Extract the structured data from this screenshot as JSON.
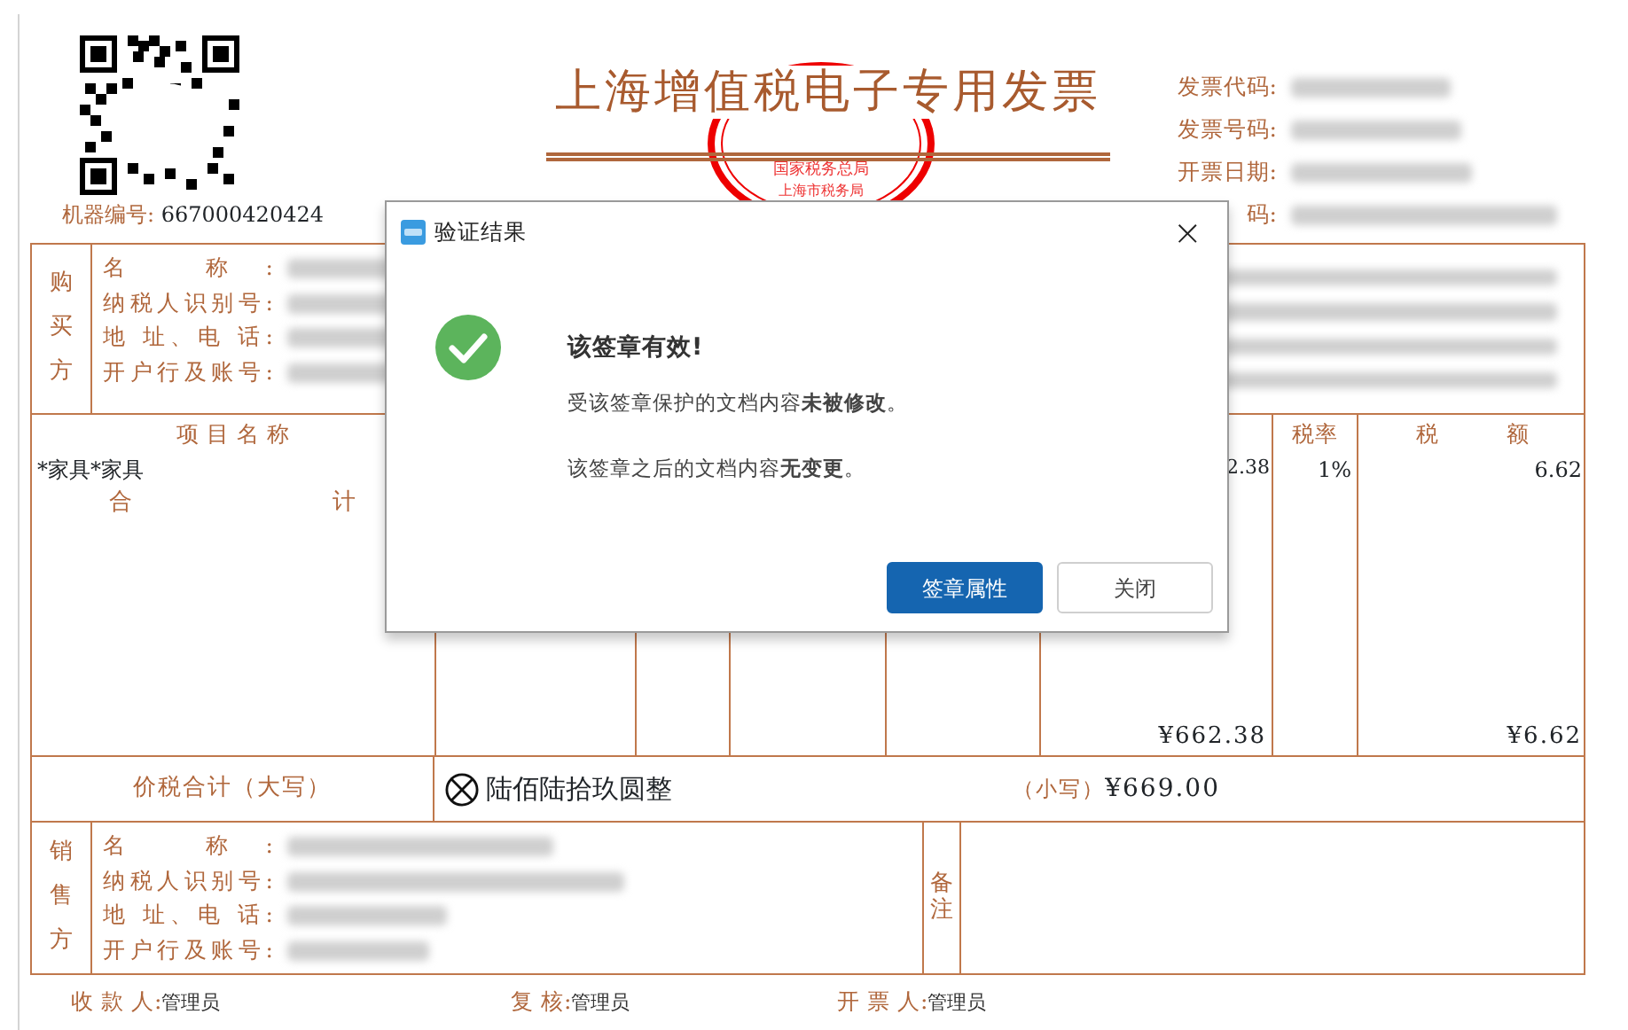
{
  "header": {
    "machine_no_label": "机器编号:",
    "machine_no": "667000420424",
    "title": "上海增值税电子专用发票",
    "seal": {
      "line1": "国家税务总局",
      "line2": "上海市税务局"
    },
    "info": [
      {
        "label": "发票代码:",
        "redacted": true
      },
      {
        "label": "发票号码:",
        "redacted": true
      },
      {
        "label": "开票日期:",
        "redacted": true
      },
      {
        "label": "码:",
        "redacted": true
      }
    ]
  },
  "buyer": {
    "side": "购买方",
    "fields": [
      {
        "label": "名 称:",
        "redacted": true
      },
      {
        "label": "纳税人识别号:",
        "redacted": true
      },
      {
        "label": "地 址、电 话:",
        "redacted": true
      },
      {
        "label": "开户行及账号:",
        "redacted": true
      }
    ],
    "cipher_redacted": true
  },
  "items": {
    "name_header": "项目名称",
    "name": "*家具*家具",
    "amount": "2.38",
    "rate_header": "税率",
    "rate": "1%",
    "tax_header": "税 额",
    "tax": "6.62",
    "total_label": "合 计",
    "total_amount": "¥662.38",
    "total_tax": "¥6.62"
  },
  "grand_total": {
    "label": "价税合计（大写）",
    "words": "陆佰陆拾玖圆整",
    "small_label": "（小写）",
    "small": "¥669.00"
  },
  "seller": {
    "side": "销售方",
    "fields": [
      {
        "label": "名 称:",
        "redacted": true
      },
      {
        "label": "纳税人识别号:",
        "redacted": true
      },
      {
        "label": "地 址、电 话:",
        "redacted": true
      },
      {
        "label": "开户行及账号:",
        "redacted": true
      }
    ],
    "remarks_label": "备注"
  },
  "footer": [
    {
      "label": "收 款 人:",
      "value": "管理员"
    },
    {
      "label": "复 核:",
      "value": "管理员"
    },
    {
      "label": "开 票 人:",
      "value": "管理员"
    }
  ],
  "dialog": {
    "title": "验证结果",
    "close": "×",
    "heading": "该签章有效!",
    "lines": [
      "受该签章保护的文档内容**未被修改**。",
      "该签章之后的文档内容**无变更**。"
    ],
    "buttons": [
      {
        "label": "签章属性",
        "primary": true
      },
      {
        "label": "关闭",
        "primary": false
      }
    ]
  }
}
